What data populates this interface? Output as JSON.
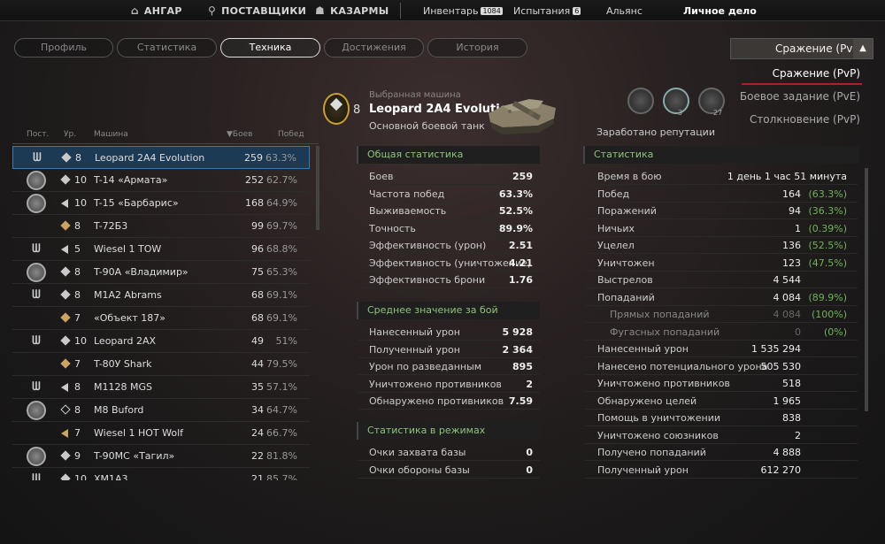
{
  "topnav": {
    "hangar": "АНГАР",
    "suppliers": "ПОСТАВЩИКИ",
    "barracks": "КАЗАРМЫ",
    "inventory": "Инвентарь",
    "inventory_count": "1084",
    "trials": "Испытания",
    "trials_count": "6",
    "alliance": "Альянс",
    "personal": "Личное дело"
  },
  "tabs": [
    "Профиль",
    "Статистика",
    "Техника",
    "Достижения",
    "История"
  ],
  "mode": {
    "selected": "Сражение (PvP)",
    "options": [
      "Сражение (PvP)",
      "Боевое задание (PvE)",
      "Столкновение (PvP)"
    ]
  },
  "vehicle": {
    "caption": "Выбранная машина",
    "tier": "8",
    "name": "Leopard 2A4 Evolution",
    "class": "Основной боевой танк"
  },
  "reputation": {
    "label": "Заработано репутации",
    "counts": [
      "",
      "3",
      "27"
    ]
  },
  "table": {
    "headers": [
      "Пост.",
      "Ур.",
      "Машина",
      "▼Боев",
      "Побед"
    ],
    "rows": [
      [
        "8",
        "Leopard 2A4 Evolution",
        "259",
        "63.3%"
      ],
      [
        "10",
        "T-14 «Армата»",
        "252",
        "62.7%"
      ],
      [
        "10",
        "T-15 «Барбарис»",
        "168",
        "64.9%"
      ],
      [
        "8",
        "T-72Б3",
        "99",
        "69.7%"
      ],
      [
        "5",
        "Wiesel 1 TOW",
        "96",
        "68.8%"
      ],
      [
        "8",
        "T-90A «Владимир»",
        "75",
        "65.3%"
      ],
      [
        "8",
        "M1A2 Abrams",
        "68",
        "69.1%"
      ],
      [
        "7",
        "«Объект 187»",
        "68",
        "69.1%"
      ],
      [
        "10",
        "Leopard 2AX",
        "49",
        "51%"
      ],
      [
        "7",
        "T-80У Shark",
        "44",
        "79.5%"
      ],
      [
        "8",
        "M1128 MGS",
        "35",
        "57.1%"
      ],
      [
        "8",
        "M8 Buford",
        "34",
        "64.7%"
      ],
      [
        "7",
        "Wiesel 1 HOT Wolf",
        "24",
        "66.7%"
      ],
      [
        "9",
        "T-90MC «Тагил»",
        "22",
        "81.8%"
      ],
      [
        "10",
        "XM1A3",
        "21",
        "85.7%"
      ]
    ]
  },
  "general": {
    "title": "Общая статистика",
    "rows": [
      [
        "Боев",
        "259"
      ],
      [
        "Частота побед",
        "63.3%"
      ],
      [
        "Выживаемость",
        "52.5%"
      ],
      [
        "Точность",
        "89.9%"
      ],
      [
        "Эффективность (урон)",
        "2.51"
      ],
      [
        "Эффективность (уничтожение)",
        "4.21"
      ],
      [
        "Эффективность брони",
        "1.76"
      ]
    ]
  },
  "average": {
    "title": "Среднее значение за бой",
    "rows": [
      [
        "Нанесенный урон",
        "5 928"
      ],
      [
        "Полученный урон",
        "2 364"
      ],
      [
        "Урон по разведанным",
        "895"
      ],
      [
        "Уничтожено противников",
        "2"
      ],
      [
        "Обнаружено противников",
        "7.59"
      ]
    ]
  },
  "modes": {
    "title": "Статистика в режимах",
    "rows": [
      [
        "Очки захвата базы",
        "0"
      ],
      [
        "Очки обороны базы",
        "0"
      ]
    ]
  },
  "stats": {
    "title": "Статистика",
    "rows": [
      [
        "Время в бою",
        "1 день 1 час 51 минута",
        ""
      ],
      [
        "Побед",
        "164",
        "(63.3%)"
      ],
      [
        "Поражений",
        "94",
        "(36.3%)"
      ],
      [
        "Ничьих",
        "1",
        "(0.39%)"
      ],
      [
        "Уцелел",
        "136",
        "(52.5%)"
      ],
      [
        "Уничтожен",
        "123",
        "(47.5%)"
      ],
      [
        "Выстрелов",
        "4 544",
        ""
      ],
      [
        "Попаданий",
        "4 084",
        "(89.9%)"
      ],
      [
        "Прямых попаданий",
        "4 084",
        "(100%)"
      ],
      [
        "Фугасных попаданий",
        "0",
        "(0%)"
      ],
      [
        "Нанесенный урон",
        "1 535 294",
        ""
      ],
      [
        "Нанесено потенциального урона",
        "505 530",
        ""
      ],
      [
        "Уничтожено противников",
        "518",
        ""
      ],
      [
        "Обнаружено целей",
        "1 965",
        ""
      ],
      [
        "Помощь в уничтожении",
        "838",
        ""
      ],
      [
        "Уничтожено союзников",
        "2",
        ""
      ],
      [
        "Получено попаданий",
        "4 888",
        ""
      ],
      [
        "Полученный урон",
        "612 270",
        ""
      ]
    ]
  }
}
